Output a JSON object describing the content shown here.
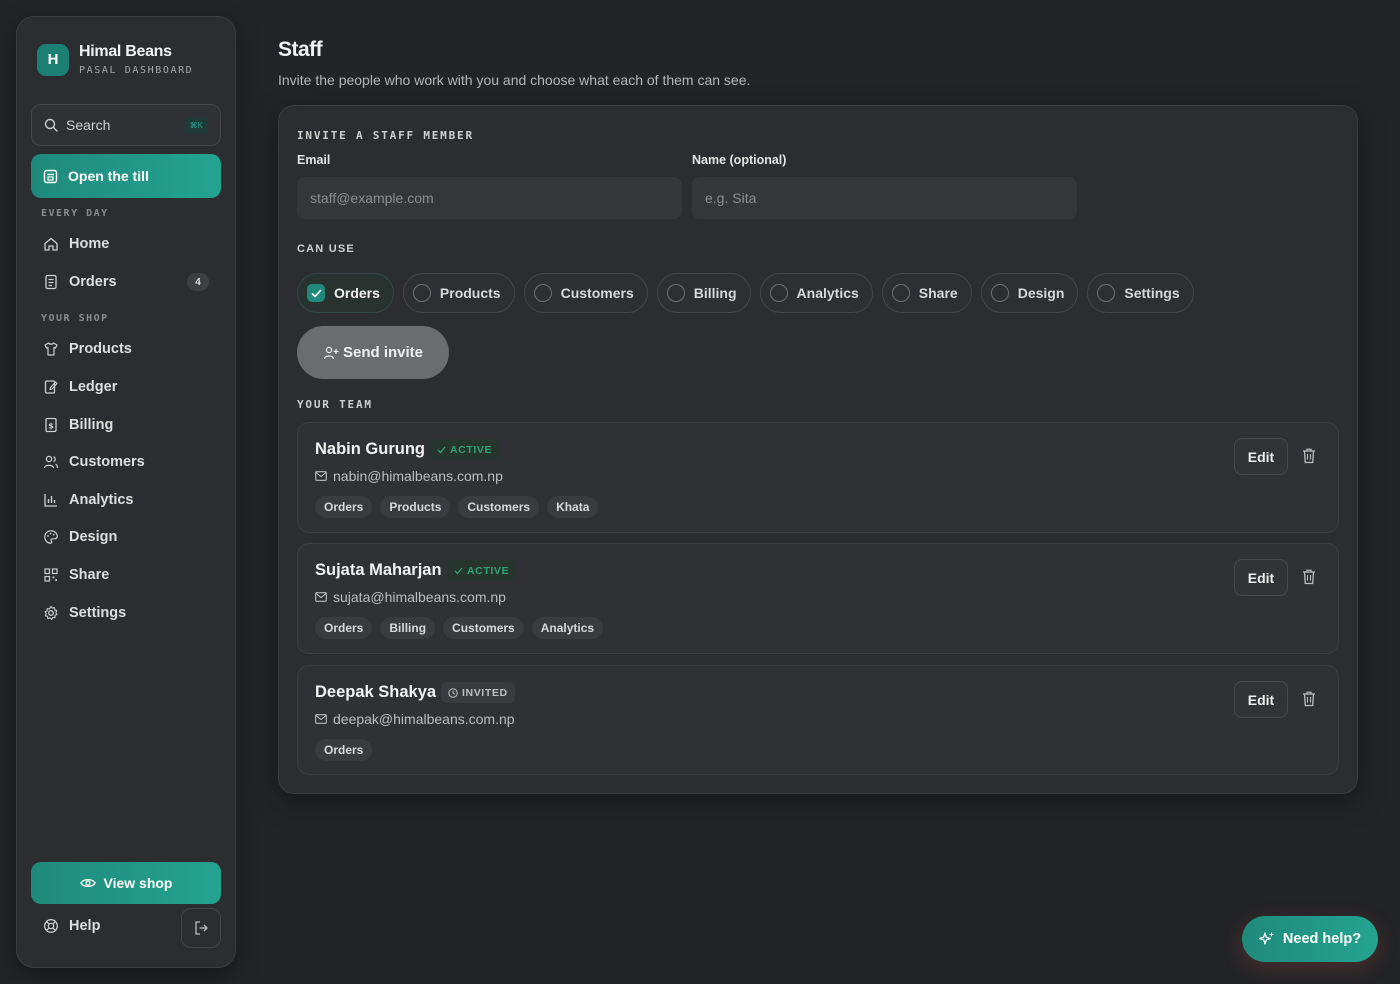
{
  "brand": {
    "logo_letter": "H",
    "name": "Himal Beans",
    "subtitle": "PASAL DASHBOARD"
  },
  "search": {
    "label": "Search",
    "shortcut": "⌘K"
  },
  "till_button": "Open the till",
  "sidebar": {
    "section_every_day": "EVERY DAY",
    "section_your_shop": "YOUR SHOP",
    "items": [
      {
        "label": "Home",
        "icon": "home-icon"
      },
      {
        "label": "Orders",
        "icon": "orders-icon",
        "count": "4"
      },
      {
        "label": "Products",
        "icon": "shirt-icon"
      },
      {
        "label": "Ledger",
        "icon": "ledger-icon"
      },
      {
        "label": "Billing",
        "icon": "billing-icon"
      },
      {
        "label": "Customers",
        "icon": "users-icon"
      },
      {
        "label": "Analytics",
        "icon": "chart-icon"
      },
      {
        "label": "Design",
        "icon": "palette-icon"
      },
      {
        "label": "Share",
        "icon": "qr-icon"
      },
      {
        "label": "Settings",
        "icon": "gear-icon"
      }
    ],
    "view_shop": "View shop",
    "help": "Help"
  },
  "page": {
    "title": "Staff",
    "subtitle": "Invite the people who work with you and choose what each of them can see."
  },
  "invite": {
    "heading": "INVITE A STAFF MEMBER",
    "email_label": "Email",
    "email_placeholder": "staff@example.com",
    "name_label": "Name (optional)",
    "name_placeholder": "e.g. Sita",
    "can_use_label": "CAN USE",
    "permissions": [
      {
        "label": "Orders",
        "checked": true
      },
      {
        "label": "Products",
        "checked": false
      },
      {
        "label": "Customers",
        "checked": false
      },
      {
        "label": "Billing",
        "checked": false
      },
      {
        "label": "Analytics",
        "checked": false
      },
      {
        "label": "Share",
        "checked": false
      },
      {
        "label": "Design",
        "checked": false
      },
      {
        "label": "Settings",
        "checked": false
      }
    ],
    "send_button": "Send invite"
  },
  "team": {
    "heading": "YOUR TEAM",
    "edit_label": "Edit",
    "members": [
      {
        "name": "Nabin Gurung",
        "status": "ACTIVE",
        "email": "nabin@himalbeans.com.np",
        "tags": [
          "Orders",
          "Products",
          "Customers",
          "Khata"
        ]
      },
      {
        "name": "Sujata Maharjan",
        "status": "ACTIVE",
        "email": "sujata@himalbeans.com.np",
        "tags": [
          "Orders",
          "Billing",
          "Customers",
          "Analytics"
        ]
      },
      {
        "name": "Deepak Shakya",
        "status": "INVITED",
        "email": "deepak@himalbeans.com.np",
        "tags": [
          "Orders"
        ]
      }
    ]
  },
  "help_button": "Need help?",
  "colors": {
    "accent": "#1f8a7c",
    "active_status": "#2fa378",
    "background": "#232427",
    "panel": "#2b2d30"
  }
}
